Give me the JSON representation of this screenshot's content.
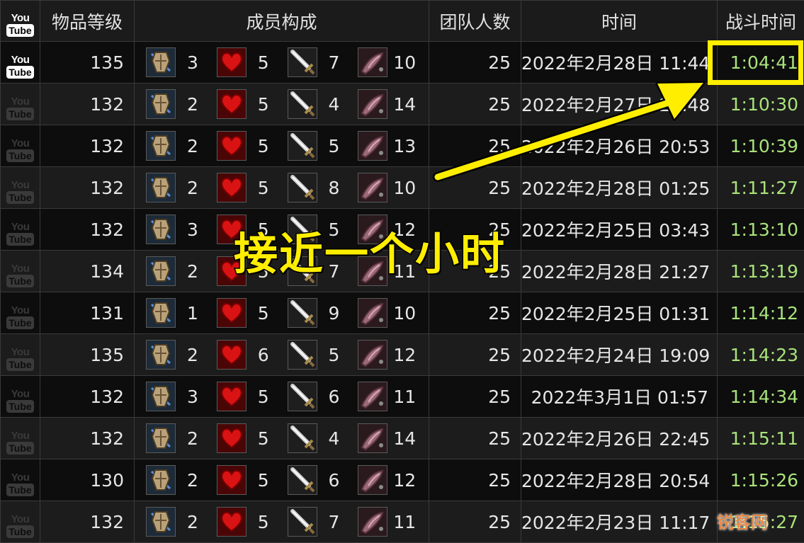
{
  "table": {
    "headers": [
      "物品等级",
      "成员构成",
      "团队人数",
      "时间",
      "战斗时间"
    ],
    "logo": {
      "top": "You",
      "bottom": "Tube"
    },
    "role_icons": [
      "tank-shield-icon",
      "healer-heart-icon",
      "melee-sword-icon",
      "ranged-cannon-icon"
    ],
    "rows": [
      {
        "ilvl": "135",
        "tank": "3",
        "healer": "5",
        "melee": "7",
        "ranged": "10",
        "players": "25",
        "time": "2022年2月28日 11:44",
        "duration": "1:04:41",
        "video_active": true
      },
      {
        "ilvl": "132",
        "tank": "2",
        "healer": "5",
        "melee": "4",
        "ranged": "14",
        "players": "25",
        "time": "2022年2月27日 21:48",
        "duration": "1:10:30",
        "video_active": false
      },
      {
        "ilvl": "132",
        "tank": "2",
        "healer": "5",
        "melee": "5",
        "ranged": "13",
        "players": "25",
        "time": "2022年2月26日 20:53",
        "duration": "1:10:39",
        "video_active": false
      },
      {
        "ilvl": "132",
        "tank": "2",
        "healer": "5",
        "melee": "8",
        "ranged": "10",
        "players": "25",
        "time": "2022年2月28日 01:25",
        "duration": "1:11:27",
        "video_active": false
      },
      {
        "ilvl": "132",
        "tank": "3",
        "healer": "5",
        "melee": "5",
        "ranged": "12",
        "players": "25",
        "time": "2022年2月25日 03:43",
        "duration": "1:13:10",
        "video_active": false
      },
      {
        "ilvl": "134",
        "tank": "2",
        "healer": "5",
        "melee": "7",
        "ranged": "11",
        "players": "25",
        "time": "2022年2月28日 21:27",
        "duration": "1:13:19",
        "video_active": false
      },
      {
        "ilvl": "131",
        "tank": "1",
        "healer": "5",
        "melee": "9",
        "ranged": "10",
        "players": "25",
        "time": "2022年2月25日 01:31",
        "duration": "1:14:12",
        "video_active": false
      },
      {
        "ilvl": "135",
        "tank": "2",
        "healer": "6",
        "melee": "5",
        "ranged": "12",
        "players": "25",
        "time": "2022年2月24日 19:09",
        "duration": "1:14:23",
        "video_active": false
      },
      {
        "ilvl": "132",
        "tank": "3",
        "healer": "5",
        "melee": "6",
        "ranged": "11",
        "players": "25",
        "time": "2022年3月1日 01:57",
        "duration": "1:14:34",
        "video_active": false
      },
      {
        "ilvl": "132",
        "tank": "2",
        "healer": "5",
        "melee": "4",
        "ranged": "14",
        "players": "25",
        "time": "2022年2月26日 22:45",
        "duration": "1:15:11",
        "video_active": false
      },
      {
        "ilvl": "130",
        "tank": "2",
        "healer": "5",
        "melee": "6",
        "ranged": "12",
        "players": "25",
        "time": "2022年2月28日 20:54",
        "duration": "1:15:26",
        "video_active": false
      },
      {
        "ilvl": "132",
        "tank": "2",
        "healer": "5",
        "melee": "7",
        "ranged": "11",
        "players": "25",
        "time": "2022年2月23日 11:17",
        "duration": "1:15:27",
        "video_active": false
      }
    ]
  },
  "annotation": {
    "text": "接近一个小时",
    "color": "#ffee00"
  },
  "watermark": {
    "text": "锐客网"
  },
  "colors": {
    "duration": "#a9e27b",
    "highlight": "#ffee00",
    "background": "#000000"
  }
}
